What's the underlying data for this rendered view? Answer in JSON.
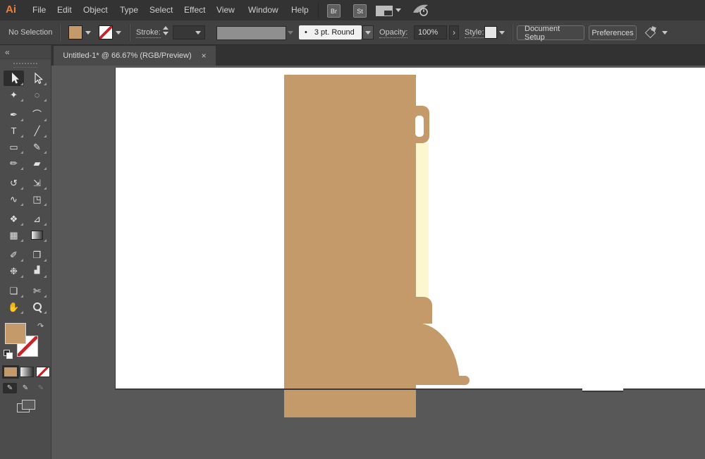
{
  "app": {
    "logo": "Ai"
  },
  "menu": {
    "items": [
      "File",
      "Edit",
      "Object",
      "Type",
      "Select",
      "Effect",
      "View",
      "Window",
      "Help"
    ],
    "bridge_badge": "Br",
    "stock_badge": "St"
  },
  "control": {
    "no_selection": "No Selection",
    "stroke_label": "Stroke:",
    "brush_dot": "•",
    "brush_name": "3 pt. Round",
    "opacity_label": "Opacity:",
    "opacity_value": "100%",
    "more_glyph": "›",
    "style_label": "Style:",
    "doc_setup": "Document Setup",
    "preferences": "Preferences",
    "fill_color": "#C59A6B",
    "stroke_none_color": "#CC2127"
  },
  "tab": {
    "title": "Untitled-1* @ 66.67% (RGB/Preview)",
    "close": "×"
  },
  "panel": {
    "collapse": "«",
    "swap_glyph": "↷"
  },
  "toolbox": {
    "fill_color": "#C59A6B",
    "tools": [
      {
        "name": "selection-tool",
        "glyph": "",
        "active": true
      },
      {
        "name": "direct-selection-tool",
        "glyph": ""
      },
      {
        "name": "magic-wand-tool",
        "glyph": "✦"
      },
      {
        "name": "lasso-tool",
        "glyph": "◌"
      },
      {
        "name": "pen-tool",
        "glyph": "✒"
      },
      {
        "name": "curvature-tool",
        "glyph": "⌒"
      },
      {
        "name": "type-tool",
        "glyph": "T"
      },
      {
        "name": "line-segment-tool",
        "glyph": "╱"
      },
      {
        "name": "rectangle-tool",
        "glyph": "▭"
      },
      {
        "name": "paintbrush-tool",
        "glyph": "✎"
      },
      {
        "name": "shaper-tool",
        "glyph": "✏"
      },
      {
        "name": "eraser-tool",
        "glyph": "▰"
      },
      {
        "name": "rotate-tool",
        "glyph": "↺"
      },
      {
        "name": "scale-tool",
        "glyph": "⇲"
      },
      {
        "name": "width-tool",
        "glyph": "∿"
      },
      {
        "name": "free-transform-tool",
        "glyph": "◳"
      },
      {
        "name": "shape-builder-tool",
        "glyph": "❖"
      },
      {
        "name": "perspective-grid-tool",
        "glyph": "⊿"
      },
      {
        "name": "mesh-tool",
        "glyph": "▦"
      },
      {
        "name": "gradient-tool",
        "glyph": ""
      },
      {
        "name": "eyedropper-tool",
        "glyph": "✐"
      },
      {
        "name": "blend-tool",
        "glyph": "❐"
      },
      {
        "name": "symbol-sprayer-tool",
        "glyph": "❉"
      },
      {
        "name": "column-graph-tool",
        "glyph": "▟"
      },
      {
        "name": "artboard-tool",
        "glyph": "❏"
      },
      {
        "name": "slice-tool",
        "glyph": "✄"
      },
      {
        "name": "hand-tool",
        "glyph": "✋"
      },
      {
        "name": "zoom-tool",
        "glyph": ""
      }
    ]
  },
  "canvas": {
    "colors": {
      "artwork_tan": "#C59A6B",
      "highlight_yellow": "#FCF7CF",
      "artboard_white": "#FFFFFF",
      "pasteboard_gray": "#585858"
    }
  }
}
